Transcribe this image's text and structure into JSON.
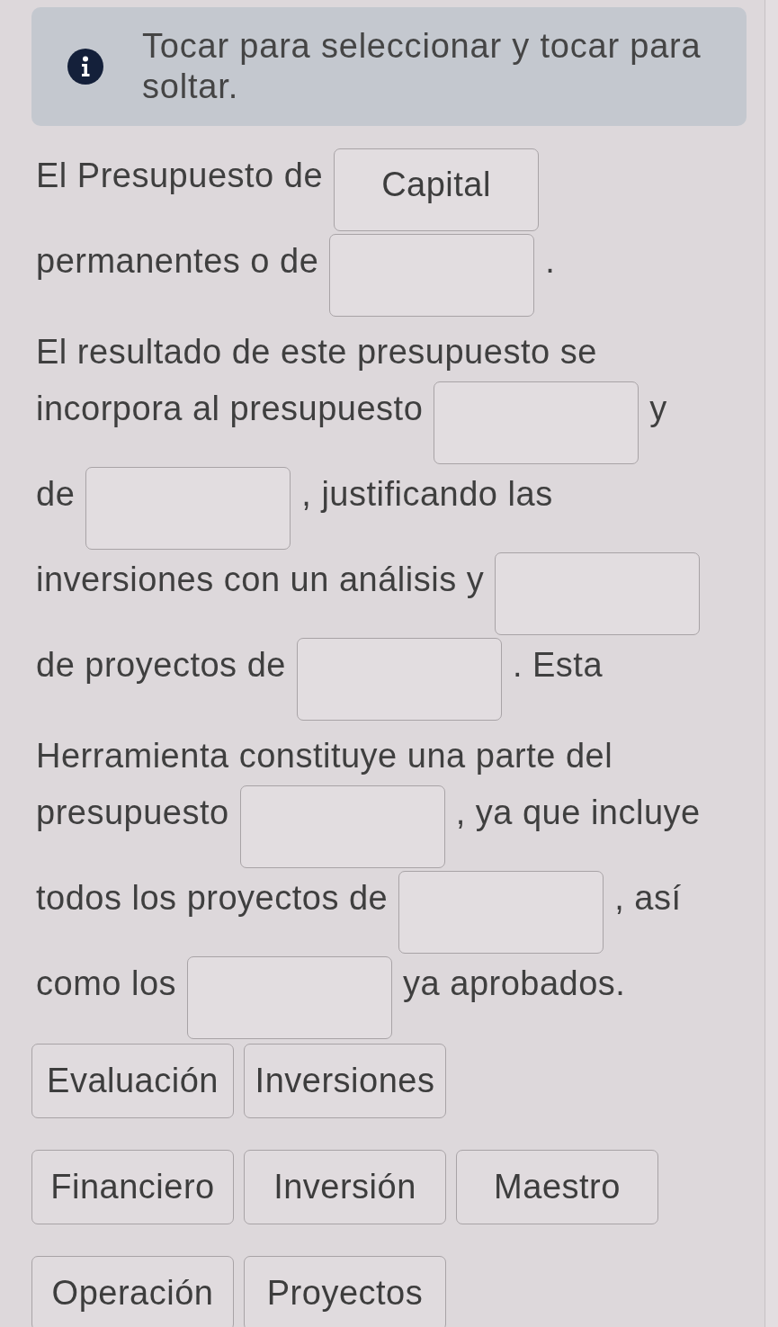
{
  "instruction": {
    "text": "Tocar para seleccionar y tocar para soltar."
  },
  "passage": {
    "lines": [
      [
        {
          "kind": "text",
          "text": "El Presupuesto de"
        },
        {
          "kind": "blank",
          "value": "Capital"
        }
      ],
      [
        {
          "kind": "text",
          "text": "permanentes o de"
        },
        {
          "kind": "blank"
        },
        {
          "kind": "text",
          "text": "."
        }
      ],
      [
        {
          "kind": "text",
          "text": "El resultado de este presupuesto se"
        }
      ],
      [
        {
          "kind": "text",
          "text": "incorpora al presupuesto"
        },
        {
          "kind": "blank"
        },
        {
          "kind": "text",
          "text": "y"
        }
      ],
      [
        {
          "kind": "text",
          "text": "de"
        },
        {
          "kind": "blank"
        },
        {
          "kind": "text",
          "text": ", justificando las"
        }
      ],
      [
        {
          "kind": "text",
          "text": "inversiones con un análisis y"
        },
        {
          "kind": "blank"
        }
      ],
      [
        {
          "kind": "text",
          "text": "de proyectos de"
        },
        {
          "kind": "blank"
        },
        {
          "kind": "text",
          "text": ". Esta"
        }
      ],
      [
        {
          "kind": "text",
          "text": "Herramienta constituye una parte del"
        }
      ],
      [
        {
          "kind": "text",
          "text": "presupuesto"
        },
        {
          "kind": "blank"
        },
        {
          "kind": "text",
          "text": ", ya que incluye"
        }
      ],
      [
        {
          "kind": "text",
          "text": "todos los proyectos de"
        },
        {
          "kind": "blank"
        },
        {
          "kind": "text",
          "text": ", así"
        }
      ],
      [
        {
          "kind": "text",
          "text": "como los"
        },
        {
          "kind": "blank"
        },
        {
          "kind": "text",
          "text": "ya aprobados."
        }
      ]
    ]
  },
  "word_bank": {
    "rows": [
      [
        "Evaluación",
        "Inversiones"
      ],
      [
        "Financiero",
        "Inversión",
        "Maestro"
      ],
      [
        "Operación",
        "Proyectos"
      ]
    ]
  }
}
